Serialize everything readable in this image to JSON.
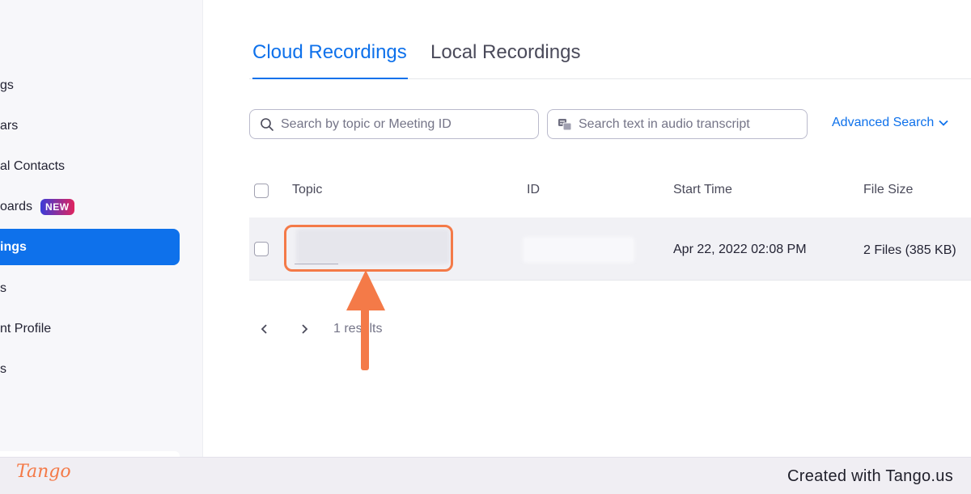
{
  "sidebar": {
    "items": [
      {
        "label": "gs"
      },
      {
        "label": "ars"
      },
      {
        "label": "al Contacts"
      },
      {
        "label": "oards",
        "badge": "NEW"
      },
      {
        "label": "ings",
        "active": true
      },
      {
        "label": "s"
      },
      {
        "label": "nt Profile"
      },
      {
        "label": "s"
      }
    ]
  },
  "tabs": [
    {
      "label": "Cloud Recordings",
      "active": true
    },
    {
      "label": "Local Recordings",
      "active": false
    }
  ],
  "search": {
    "topic_placeholder": "Search by topic or Meeting ID",
    "transcript_placeholder": "Search text in audio transcript",
    "advanced_label": "Advanced Search"
  },
  "table": {
    "headers": [
      "Topic",
      "ID",
      "Start Time",
      "File Size"
    ],
    "rows": [
      {
        "topic": "",
        "id": "",
        "start_time": "Apr 22, 2022 02:08 PM",
        "file_size": "2 Files (385 KB)"
      }
    ]
  },
  "pagination": {
    "results_text": "1 results"
  },
  "footer": {
    "logo": "Tango",
    "text": "Created with Tango.us"
  },
  "colors": {
    "accent": "#0e71eb",
    "annotation": "#f47a48"
  }
}
